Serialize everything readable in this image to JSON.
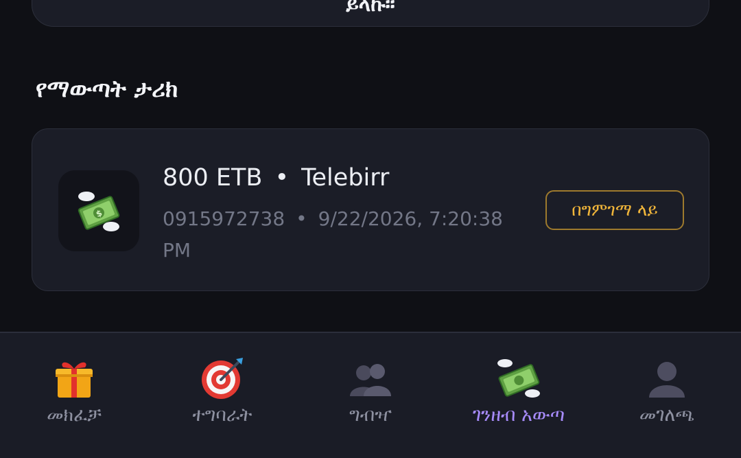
{
  "top_card": {
    "text": "ይላኩ።"
  },
  "section": {
    "title": "የማውጣት ታሪክ"
  },
  "history": [
    {
      "amount": "800 ETB",
      "method": "Telebirr",
      "phone": "0915972738",
      "datetime": "9/22/2026, 7:20:38 PM",
      "status": "በግምገማ ላይ",
      "icon": "money-with-wings-icon"
    }
  ],
  "colors": {
    "background": "#0f1015",
    "card": "#1b1d27",
    "status_pending": "#f0b53a",
    "nav_active": "#a78bfa",
    "nav_inactive": "#8d90a0"
  },
  "nav": {
    "items": [
      {
        "label": "መክፈቻ",
        "icon": "gift-icon",
        "active": false
      },
      {
        "label": "ተግባራት",
        "icon": "target-icon",
        "active": false
      },
      {
        "label": "ግብዣ",
        "icon": "users-icon",
        "active": false
      },
      {
        "label": "ገንዘብ አውጣ",
        "icon": "money-with-wings-icon",
        "active": true
      },
      {
        "label": "መገለጫ",
        "icon": "user-icon",
        "active": false
      }
    ]
  }
}
